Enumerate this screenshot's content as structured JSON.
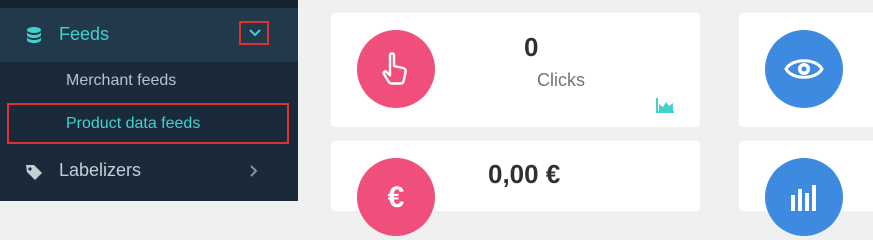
{
  "sidebar": {
    "feeds": {
      "label": "Feeds",
      "icon": "database-icon"
    },
    "sub_items": [
      {
        "label": "Merchant feeds"
      },
      {
        "label": "Product data feeds"
      }
    ],
    "labelizers": {
      "label": "Labelizers",
      "icon": "tag-icon"
    }
  },
  "cards": {
    "clicks": {
      "value": "0",
      "label": "Clicks",
      "icon": "hand-pointer-icon",
      "color": "#ef4f7a"
    },
    "views": {
      "icon": "eye-icon",
      "color": "#3e8ae0"
    },
    "cost": {
      "value": "0,00 €",
      "icon": "euro-icon",
      "color": "#ef4f7a"
    },
    "stats": {
      "icon": "bar-chart-icon",
      "color": "#3e8ae0"
    }
  },
  "colors": {
    "accent": "#43d1cf",
    "highlight_border": "#e0322d",
    "sidebar_bg": "#1b2a3a"
  }
}
